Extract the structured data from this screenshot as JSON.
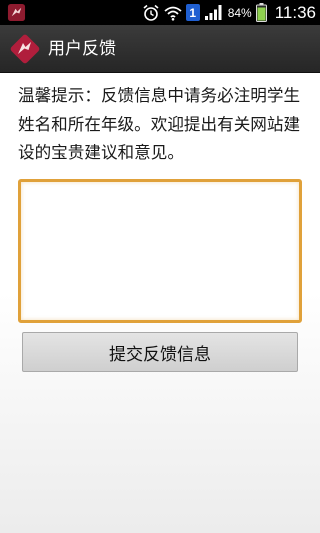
{
  "status_bar": {
    "notification_badge": "1",
    "battery_percent": "84%",
    "time": "11:36"
  },
  "action_bar": {
    "title": "用户反馈"
  },
  "main": {
    "tip": "温馨提示：反馈信息中请务必注明学生姓名和所在年级。欢迎提出有关网站建设的宝贵建议和意见。",
    "feedback_value": "",
    "submit_label": "提交反馈信息"
  },
  "colors": {
    "accent": "#e0a13a",
    "logo": "#b01e3c",
    "status_badge": "#1f5fd1",
    "battery": "#8fd14f"
  }
}
